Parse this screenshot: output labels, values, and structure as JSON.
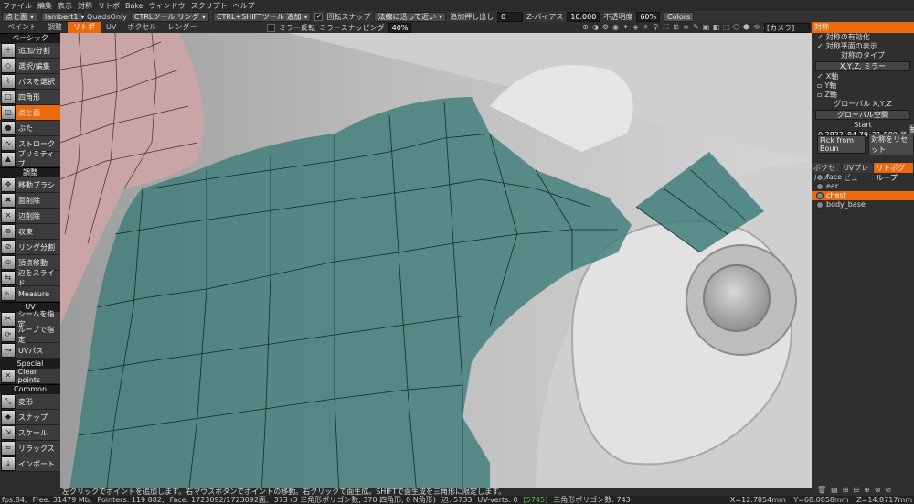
{
  "menu": [
    "ファイル",
    "編集",
    "表示",
    "対称",
    "リトポ",
    "Bake",
    "ウィンドウ",
    "スクリプト",
    "ヘルプ"
  ],
  "toolbar": {
    "mode": "点と面",
    "material": "lambert1",
    "quads_only": "QuadsOnly",
    "ctrl_tool": "CTRLツール リング",
    "ctrl_shift_tool": "CTRL+SHIFTツール 追加",
    "snap_label": "回転スナップ",
    "surface_dd": "法線に沿って近い",
    "extrude_label": "追加押し出し",
    "extrude_value": "0",
    "zbias_label": "Z-バイアス",
    "zbias_value": "10.000",
    "opacity_label": "不透明度",
    "opacity_value": "60%",
    "colors_btn": "Colors",
    "mirror_label": "ミラー反転",
    "mirror_snap_label": "ミラースナッピング",
    "mirror_snap_value": "40%"
  },
  "tabs": [
    {
      "label": "ペイント",
      "active": false
    },
    {
      "label": "調整",
      "active": false
    },
    {
      "label": "リトポ",
      "active": true
    },
    {
      "label": "UV",
      "active": false
    },
    {
      "label": "ボクセル",
      "active": false
    },
    {
      "label": "レンダー",
      "active": false
    }
  ],
  "view_icons": [
    "⊕",
    "◑",
    "⚙",
    "◉",
    "✦",
    "◈",
    "☀",
    "⚲",
    "⛶",
    "⊞",
    "≡",
    "✎",
    "▣",
    "◧",
    "⬚",
    "⬡",
    "⬢",
    "⟲",
    "◎",
    "▦"
  ],
  "camera": "[カメラ]",
  "tool_sections": [
    {
      "title": "ベーシック",
      "tools": [
        {
          "label": "追加/分割",
          "icon": "＋",
          "name": "add-split-tool",
          "active": false
        },
        {
          "label": "選択/編集",
          "icon": "◇",
          "name": "select-edit-tool",
          "active": false
        },
        {
          "label": "パスを選択",
          "icon": "⌇",
          "name": "select-path-tool",
          "active": false
        },
        {
          "label": "四角形",
          "icon": "□",
          "name": "quad-tool",
          "active": false
        },
        {
          "label": "点と面",
          "icon": "◫",
          "name": "points-faces-tool",
          "active": true
        },
        {
          "label": "ぶた",
          "icon": "●",
          "name": "cap-tool",
          "active": false
        },
        {
          "label": "ストローク",
          "icon": "∿",
          "name": "stroke-tool",
          "active": false
        },
        {
          "label": "プリミティブ",
          "icon": "▲",
          "name": "primitive-tool",
          "active": false
        }
      ]
    },
    {
      "title": "調整",
      "tools": [
        {
          "label": "移動ブラシ",
          "icon": "✥",
          "name": "move-brush-tool",
          "active": false
        },
        {
          "label": "面削除",
          "icon": "✖",
          "name": "delete-face-tool",
          "active": false
        },
        {
          "label": "辺削除",
          "icon": "✕",
          "name": "delete-edge-tool",
          "active": false
        },
        {
          "label": "収束",
          "icon": "⊗",
          "name": "collapse-tool",
          "active": false
        },
        {
          "label": "リング分割",
          "icon": "⊘",
          "name": "ring-split-tool",
          "active": false
        },
        {
          "label": "頂点移動",
          "icon": "⊙",
          "name": "vertex-move-tool",
          "active": false
        },
        {
          "label": "辺をスライド",
          "icon": "⇆",
          "name": "edge-slide-tool",
          "active": false
        },
        {
          "label": "Measure",
          "icon": "⊾",
          "name": "measure-tool",
          "active": false
        }
      ]
    },
    {
      "title": "UV",
      "tools": [
        {
          "label": "シームを指定",
          "icon": "✂",
          "name": "mark-seam-tool",
          "active": false
        },
        {
          "label": "ループで指定",
          "icon": "⟳",
          "name": "loop-mark-tool",
          "active": false
        },
        {
          "label": "UVパス",
          "icon": "↝",
          "name": "uv-path-tool",
          "active": false
        }
      ]
    },
    {
      "title": "Special",
      "tools": [
        {
          "label": "Clear points",
          "icon": "✕",
          "name": "clear-points-tool",
          "active": false
        }
      ]
    },
    {
      "title": "Common",
      "tools": [
        {
          "label": "変形",
          "icon": "⤡",
          "name": "transform-tool",
          "active": false
        },
        {
          "label": "スナップ",
          "icon": "◆",
          "name": "snap-tool",
          "active": false
        },
        {
          "label": "スケール",
          "icon": "⇲",
          "name": "scale-tool",
          "active": false
        },
        {
          "label": "リラックス",
          "icon": "≈",
          "name": "relax-tool",
          "active": false
        },
        {
          "label": "インポート",
          "icon": "⤓",
          "name": "import-tool",
          "active": false
        }
      ]
    }
  ],
  "right_panel": {
    "header": "対称",
    "enable_sym": "対称の有効化",
    "show_plane": "対称平面の表示",
    "type_title": "対称のタイプ",
    "type_value": "X,Y,Z, ミラー",
    "x_axis": "X軸",
    "y_axis": "Y軸",
    "z_axis": "Z軸",
    "global_label": "グローバル  X,Y,Z",
    "global_dd": "グローバル空間",
    "start_label": "Start",
    "start_x": "0.2822",
    "start_y": "84.79",
    "start_z": "21.580",
    "start_x_btn": "X",
    "extract_btn": "抽出",
    "pick_btn": "Pick from Boun",
    "reset_btn": "対称をリセット"
  },
  "right_tabs": [
    {
      "label": "ボクセルツ",
      "active": false
    },
    {
      "label": "UVプレビュ",
      "active": false
    },
    {
      "label": "リトポグループ",
      "active": true
    }
  ],
  "groups": [
    {
      "name": "face",
      "selected": false
    },
    {
      "name": "ear",
      "selected": false
    },
    {
      "name": "chest",
      "selected": true
    },
    {
      "name": "body_base",
      "selected": false
    }
  ],
  "right_bottom_icons": [
    "🗑",
    "▤",
    "⊞",
    "⊟",
    "⊕",
    "⊗",
    "⊘"
  ],
  "hint": "左クリックでポイントを追加します。右マウスボタンでポイントの移動。右クリックで面生成。SHIFTで面生成を三角形に限定します。",
  "status": {
    "fps": "fps:84;",
    "free": "Free: 31479 Mb,",
    "pointers": "Pointers: 119 882;",
    "face": "Face: 1723092/1723092面;",
    "tris": "373 (3 三角形ポリゴン数, 370 四角形, 0 N角形)",
    "edges": "辺: 5733",
    "uv_verts_label": "UV-verts: 0",
    "uv_verts_value": "[5745]",
    "tri_count": "三角形ポリゴン数: 743",
    "x": "X=12.7854mm",
    "y": "Y=68.0858mm",
    "z": "Z=14.8717mm"
  }
}
